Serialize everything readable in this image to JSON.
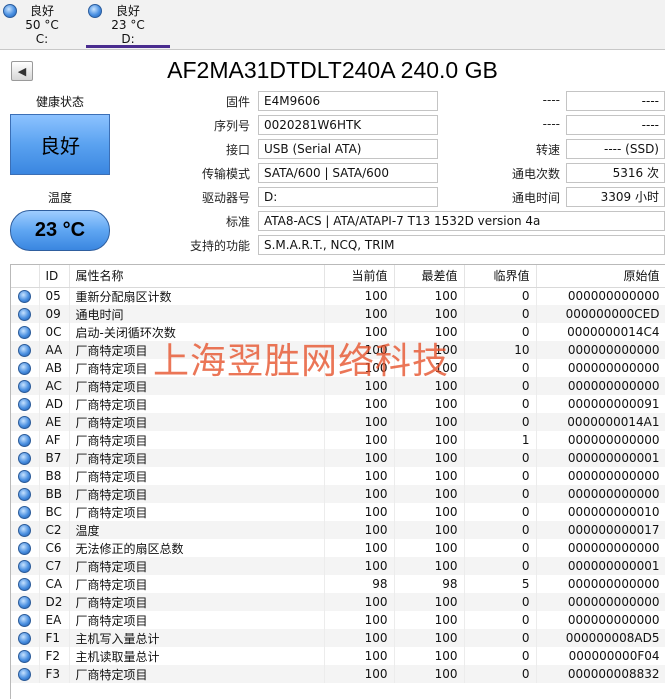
{
  "drives": [
    {
      "status": "良好",
      "temp": "50 °C",
      "letter": "C:"
    },
    {
      "status": "良好",
      "temp": "23 °C",
      "letter": "D:"
    }
  ],
  "title": "AF2MA31DTDLT240A 240.0 GB",
  "health": {
    "label": "健康状态",
    "value": "良好"
  },
  "temperature": {
    "label": "温度",
    "value": "23 °C"
  },
  "info": {
    "firmware": {
      "label": "固件",
      "value": "E4M9606"
    },
    "serial": {
      "label": "序列号",
      "value": "0020281W6HTK"
    },
    "interface": {
      "label": "接口",
      "value": "USB (Serial ATA)"
    },
    "transfer_mode": {
      "label": "传输模式",
      "value": "SATA/600 | SATA/600"
    },
    "drive_letter": {
      "label": "驱动器号",
      "value": "D:"
    },
    "standard": {
      "label": "标准",
      "value": "ATA8-ACS | ATA/ATAPI-7 T13 1532D version 4a"
    },
    "features": {
      "label": "支持的功能",
      "value": "S.M.A.R.T., NCQ, TRIM"
    },
    "blank1": {
      "label": "----",
      "value": "----"
    },
    "blank2": {
      "label": "----",
      "value": "----"
    },
    "rotation": {
      "label": "转速",
      "value": "---- (SSD)"
    },
    "power_on_count": {
      "label": "通电次数",
      "value": "5316 次"
    },
    "power_on_hours": {
      "label": "通电时间",
      "value": "3309 小时"
    }
  },
  "table": {
    "headers": {
      "id": "ID",
      "name": "属性名称",
      "current": "当前值",
      "worst": "最差值",
      "threshold": "临界值",
      "raw": "原始值"
    },
    "rows": [
      {
        "id": "05",
        "name": "重新分配扇区计数",
        "current": "100",
        "worst": "100",
        "threshold": "0",
        "raw": "000000000000"
      },
      {
        "id": "09",
        "name": "通电时间",
        "current": "100",
        "worst": "100",
        "threshold": "0",
        "raw": "000000000CED"
      },
      {
        "id": "0C",
        "name": "启动-关闭循环次数",
        "current": "100",
        "worst": "100",
        "threshold": "0",
        "raw": "0000000014C4"
      },
      {
        "id": "AA",
        "name": "厂商特定项目",
        "current": "100",
        "worst": "100",
        "threshold": "10",
        "raw": "000000000000"
      },
      {
        "id": "AB",
        "name": "厂商特定项目",
        "current": "100",
        "worst": "100",
        "threshold": "0",
        "raw": "000000000000"
      },
      {
        "id": "AC",
        "name": "厂商特定项目",
        "current": "100",
        "worst": "100",
        "threshold": "0",
        "raw": "000000000000"
      },
      {
        "id": "AD",
        "name": "厂商特定项目",
        "current": "100",
        "worst": "100",
        "threshold": "0",
        "raw": "000000000091"
      },
      {
        "id": "AE",
        "name": "厂商特定项目",
        "current": "100",
        "worst": "100",
        "threshold": "0",
        "raw": "0000000014A1"
      },
      {
        "id": "AF",
        "name": "厂商特定项目",
        "current": "100",
        "worst": "100",
        "threshold": "1",
        "raw": "000000000000"
      },
      {
        "id": "B7",
        "name": "厂商特定项目",
        "current": "100",
        "worst": "100",
        "threshold": "0",
        "raw": "000000000001"
      },
      {
        "id": "B8",
        "name": "厂商特定项目",
        "current": "100",
        "worst": "100",
        "threshold": "0",
        "raw": "000000000000"
      },
      {
        "id": "BB",
        "name": "厂商特定项目",
        "current": "100",
        "worst": "100",
        "threshold": "0",
        "raw": "000000000000"
      },
      {
        "id": "BC",
        "name": "厂商特定项目",
        "current": "100",
        "worst": "100",
        "threshold": "0",
        "raw": "000000000010"
      },
      {
        "id": "C2",
        "name": "温度",
        "current": "100",
        "worst": "100",
        "threshold": "0",
        "raw": "000000000017"
      },
      {
        "id": "C6",
        "name": "无法修正的扇区总数",
        "current": "100",
        "worst": "100",
        "threshold": "0",
        "raw": "000000000000"
      },
      {
        "id": "C7",
        "name": "厂商特定项目",
        "current": "100",
        "worst": "100",
        "threshold": "0",
        "raw": "000000000001"
      },
      {
        "id": "CA",
        "name": "厂商特定项目",
        "current": "98",
        "worst": "98",
        "threshold": "5",
        "raw": "000000000000"
      },
      {
        "id": "D2",
        "name": "厂商特定项目",
        "current": "100",
        "worst": "100",
        "threshold": "0",
        "raw": "000000000000"
      },
      {
        "id": "EA",
        "name": "厂商特定项目",
        "current": "100",
        "worst": "100",
        "threshold": "0",
        "raw": "000000000000"
      },
      {
        "id": "F1",
        "name": "主机写入量总计",
        "current": "100",
        "worst": "100",
        "threshold": "0",
        "raw": "000000008AD5"
      },
      {
        "id": "F2",
        "name": "主机读取量总计",
        "current": "100",
        "worst": "100",
        "threshold": "0",
        "raw": "000000000F04"
      },
      {
        "id": "F3",
        "name": "厂商特定项目",
        "current": "100",
        "worst": "100",
        "threshold": "0",
        "raw": "000000008832"
      }
    ]
  },
  "watermark": "上海翌胜网络科技",
  "colors": {
    "health_blue": "#5aa2f0",
    "tab_underline": "#4a2d8f",
    "watermark": "#e65028"
  }
}
